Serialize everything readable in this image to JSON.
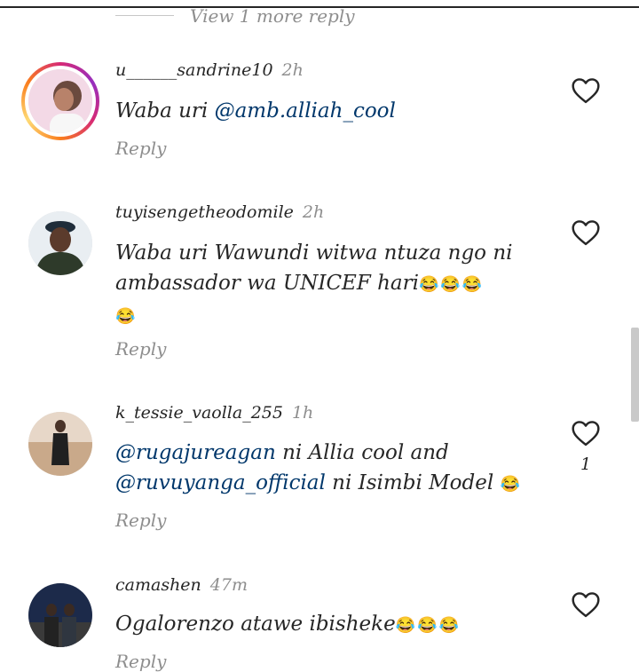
{
  "thread": {
    "more_replies": "View 1 more reply"
  },
  "comments": [
    {
      "username": "u______sandrine10",
      "time": "2h",
      "text": [
        {
          "t": "Waba uri "
        },
        {
          "m": "@amb.alliah_cool"
        }
      ],
      "reply": "Reply",
      "has_story": true,
      "likes": ""
    },
    {
      "username": "tuyisengetheodomile",
      "time": "2h",
      "text_line1": "Waba uri Wawundi witwa  ntuza ngo ni",
      "text_line2": "ambassador wa UNICEF  hari",
      "emoji_a": "😂😂😂",
      "emoji_b": "😂",
      "reply": "Reply",
      "likes": ""
    },
    {
      "username": "k_tessie_vaolla_255",
      "time": "1h",
      "mention1": "@rugajureagan",
      "rest1": " ni Allia cool and",
      "mention2": "@ruvuyanga_official",
      "rest2": " ni Isimbi Model ",
      "emoji": "😂",
      "reply": "Reply",
      "likes": "1"
    },
    {
      "username": "camashen",
      "time": "47m",
      "text": "Ogalorenzo atawe ibisheke",
      "emoji": "😂😂😂",
      "reply": "Reply",
      "likes": ""
    }
  ],
  "icons": {
    "like": "heart-outline-icon"
  },
  "colors": {
    "mention": "#00376b",
    "muted": "#8e8e8e",
    "text": "#262626"
  }
}
